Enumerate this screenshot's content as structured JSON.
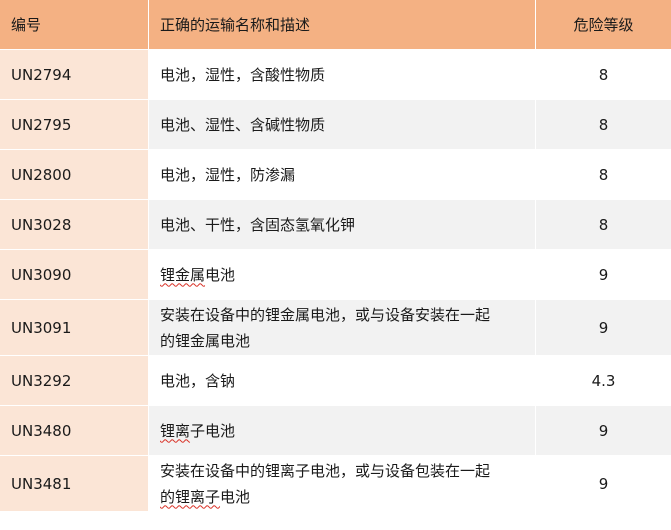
{
  "header": {
    "code": "编号",
    "name": "正确的运输名称和描述",
    "class": "危险等级"
  },
  "rows": [
    {
      "code": "UN2794",
      "name": "电池，湿性，含酸性物质",
      "class": "8"
    },
    {
      "code": "UN2795",
      "name": "电池、湿性、含碱性物质",
      "class": "8"
    },
    {
      "code": "UN2800",
      "name": "电池，湿性，防渗漏",
      "class": "8"
    },
    {
      "code": "UN3028",
      "name": "电池、干性，含固态氢氧化钾",
      "class": "8"
    },
    {
      "code": "UN3090",
      "name_a": "锂金属",
      "name_b": "电池",
      "class": "9"
    },
    {
      "code": "UN3091",
      "name_l1": "安装在设备中的锂金属电池，或与设备安装在一起",
      "name_l2": "的锂金属电池",
      "class": "9"
    },
    {
      "code": "UN3292",
      "name": "电池，含钠",
      "class": "4.3"
    },
    {
      "code": "UN3480",
      "name_a": "锂离",
      "name_b": "子电池",
      "class": "9"
    },
    {
      "code": "UN3481",
      "name_l1_a": "安装在设备中的锂离子电池，或与设备包装在一起",
      "name_l2_a": "的锂离子",
      "name_l2_b": "电池",
      "class": "9"
    }
  ]
}
